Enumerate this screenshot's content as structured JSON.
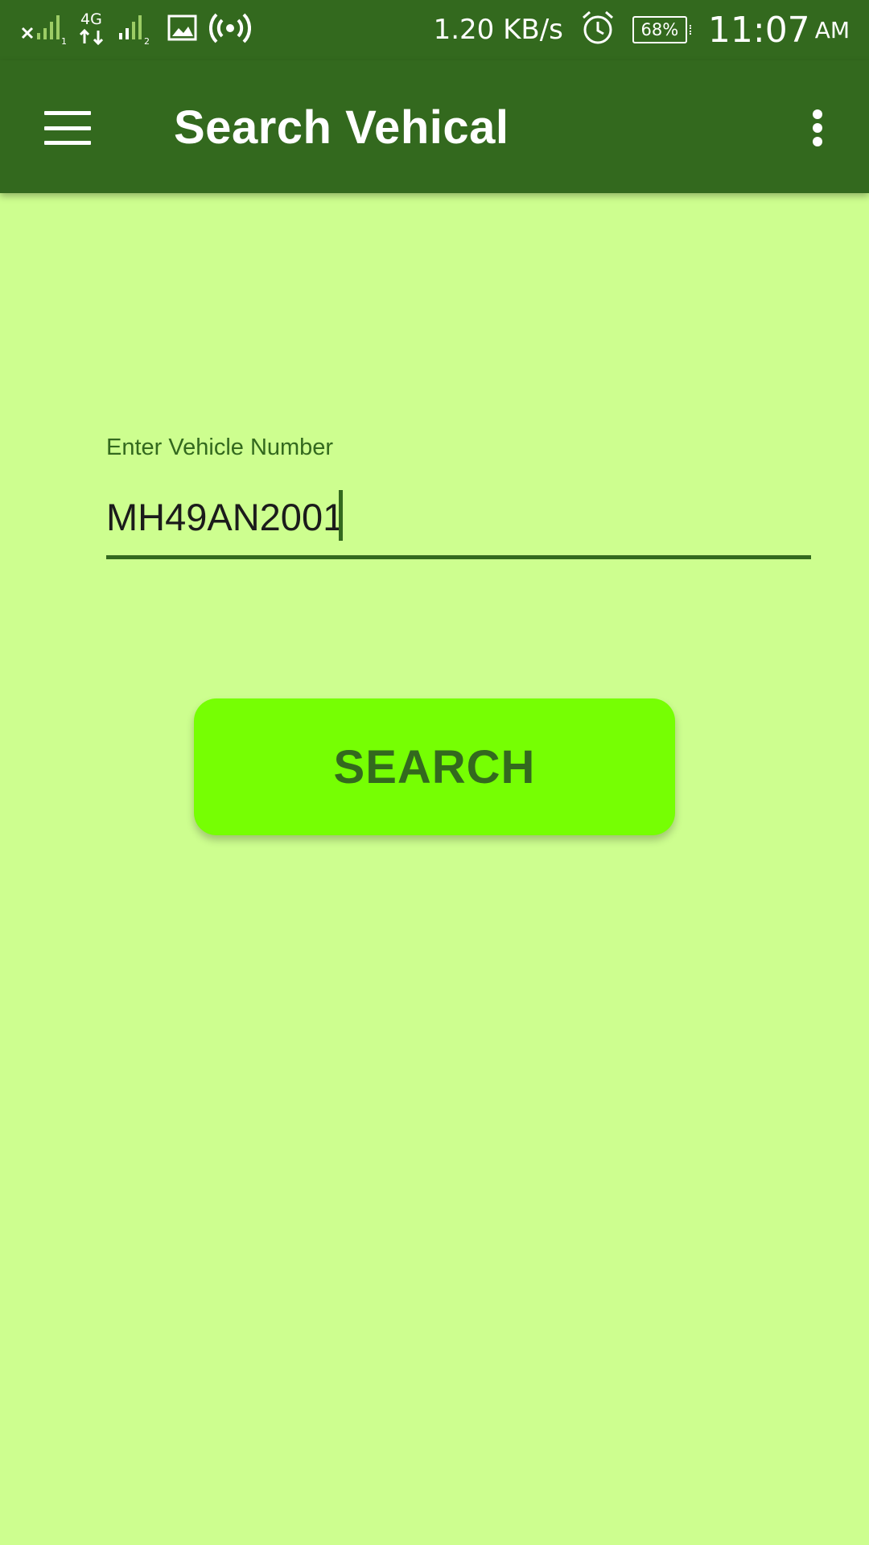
{
  "status_bar": {
    "network_speed": "1.20 KB/s",
    "battery_percent": "68%",
    "time": "11:07",
    "ampm": "AM",
    "network_type": "4G",
    "icons": [
      "no-signal-sim1-icon",
      "4g-data-icon",
      "signal-sim2-icon",
      "gallery-notification-icon",
      "hotspot-icon",
      "alarm-icon",
      "battery-icon"
    ]
  },
  "app_bar": {
    "title": "Search Vehical",
    "menu_icon": "hamburger-menu-icon",
    "overflow_icon": "more-vert-icon"
  },
  "form": {
    "vehicle_number_label": "Enter Vehicle Number",
    "vehicle_number_value": "MH49AN2001"
  },
  "search_button": {
    "label": "SEARCH"
  },
  "colors": {
    "primary_dark": "#33691e",
    "background": "#cdfe8f",
    "accent": "#76ff03",
    "on_primary": "#ffffff"
  }
}
